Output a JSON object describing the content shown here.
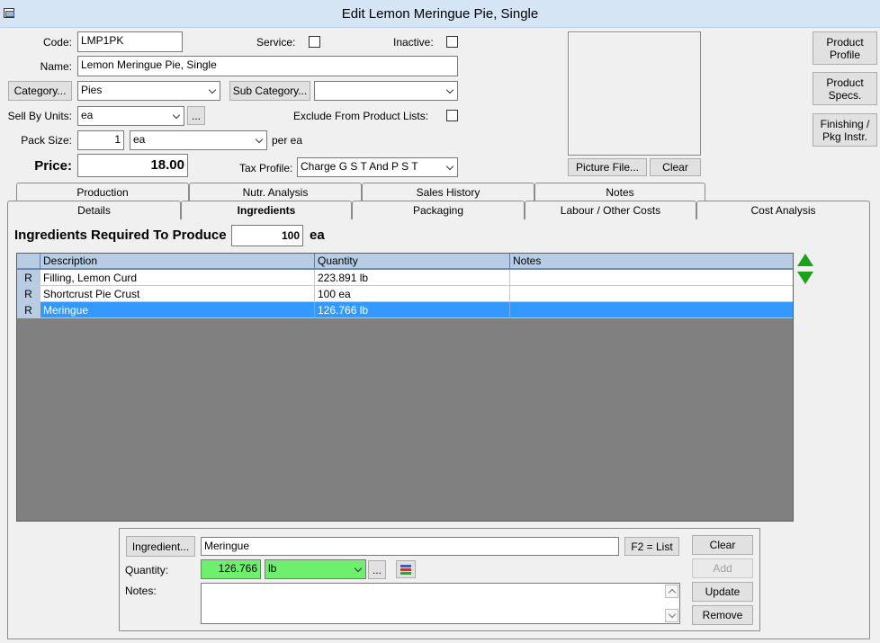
{
  "window": {
    "title": "Edit Lemon Meringue Pie, Single"
  },
  "header": {
    "code_label": "Code:",
    "code_value": "LMP1PK",
    "service_label": "Service:",
    "inactive_label": "Inactive:",
    "name_label": "Name:",
    "name_value": "Lemon Meringue Pie, Single",
    "category_button": "Category...",
    "category_value": "Pies",
    "subcategory_button": "Sub Category...",
    "subcategory_value": "",
    "sell_by_units_label": "Sell By Units:",
    "sell_by_units_value": "ea",
    "ellipsis": "...",
    "exclude_label": "Exclude From Product Lists:",
    "pack_size_label": "Pack Size:",
    "pack_size_value": "1",
    "pack_size_unit": "ea",
    "per_label": "per ea",
    "price_label": "Price:",
    "price_value": "18.00",
    "tax_profile_label": "Tax Profile:",
    "tax_profile_value": "Charge G S T And P S T",
    "picture_file_button": "Picture File...",
    "picture_clear_button": "Clear"
  },
  "side_buttons": {
    "product_profile": [
      "Product",
      "Profile"
    ],
    "product_specs": [
      "Product",
      "Specs."
    ],
    "finishing": [
      "Finishing /",
      "Pkg Instr."
    ]
  },
  "tabs_top": [
    "Production",
    "Nutr. Analysis",
    "Sales History",
    "Notes"
  ],
  "tabs_bottom": [
    "Details",
    "Ingredients",
    "Packaging",
    "Labour / Other Costs",
    "Cost Analysis"
  ],
  "ingredients": {
    "produce_label": "Ingredients Required To Produce",
    "produce_qty": "100",
    "produce_unit": "ea",
    "columns": [
      "Description",
      "Quantity",
      "Notes"
    ],
    "rows": [
      {
        "flag": "R",
        "description": "Filling, Lemon Curd",
        "quantity": "223.891 lb",
        "notes": ""
      },
      {
        "flag": "R",
        "description": "Shortcrust Pie Crust",
        "quantity": "100 ea",
        "notes": ""
      },
      {
        "flag": "R",
        "description": "Meringue",
        "quantity": "126.766 lb",
        "notes": ""
      }
    ]
  },
  "editor": {
    "ingredient_button": "Ingredient...",
    "ingredient_value": "Meringue",
    "f2_button": "F2 = List",
    "quantity_label": "Quantity:",
    "quantity_value": "126.766",
    "quantity_unit": "lb",
    "ellipsis": "...",
    "notes_label": "Notes:",
    "notes_value": "",
    "clear_button": "Clear",
    "add_button": "Add",
    "update_button": "Update",
    "remove_button": "Remove"
  },
  "colors": {
    "selection": "#3399ff",
    "header_blue": "#b8cce4",
    "highlight_green": "#6ef06e",
    "grid_bg": "#808080"
  }
}
